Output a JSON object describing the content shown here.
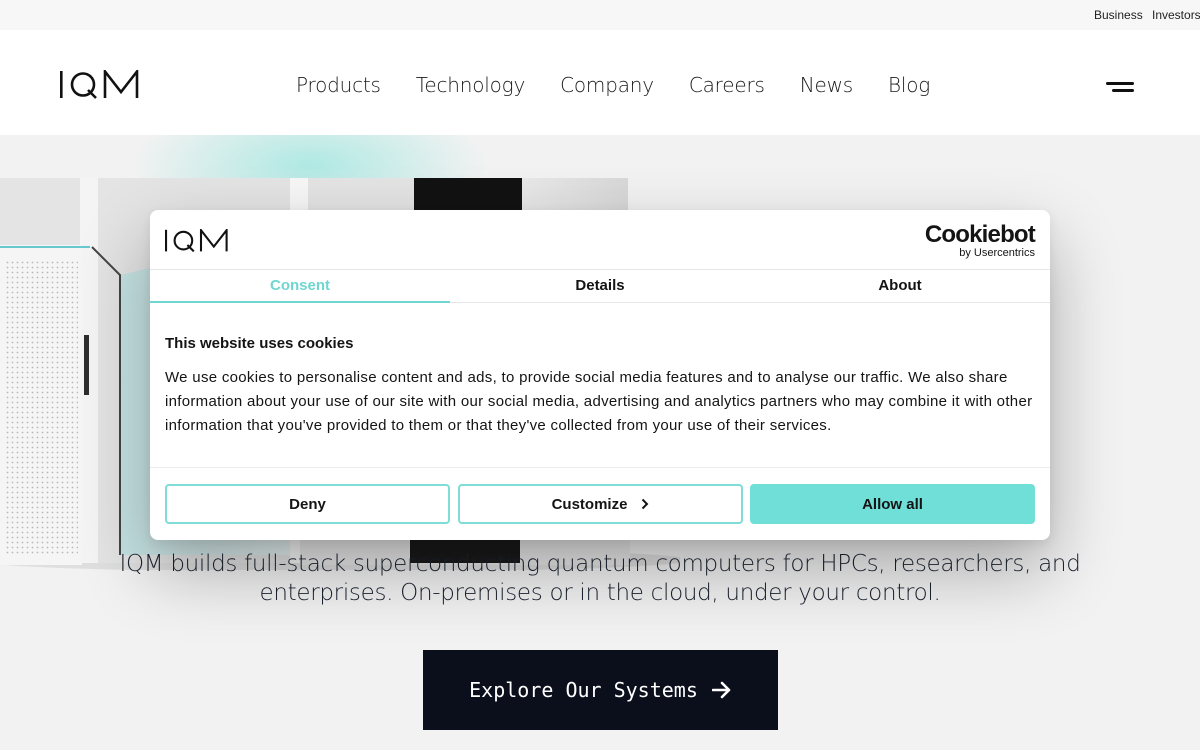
{
  "util_links": [
    "Business",
    "Investors"
  ],
  "header": {
    "brand": "IQM",
    "nav": [
      "Products",
      "Technology",
      "Company",
      "Careers",
      "News",
      "Blog"
    ]
  },
  "hero": {
    "line1": "IQM builds full-stack superconducting quantum computers for HPCs, researchers, and",
    "line2": "enterprises. On-premises or in the cloud, under your control.",
    "cta_label": "Explore Our Systems"
  },
  "cookie": {
    "provider_main": "Cookiebot",
    "provider_sub": "by Usercentrics",
    "tabs": [
      "Consent",
      "Details",
      "About"
    ],
    "active_tab": "Consent",
    "title": "This website uses cookies",
    "description": "We use cookies to personalise content and ads, to provide social media features and to analyse our traffic. We also share information about your use of our site with our social media, advertising and analytics partners who may combine it with other information that you've provided to them or that they've collected from your use of their services.",
    "deny_label": "Deny",
    "customize_label": "Customize",
    "allow_label": "Allow all"
  },
  "colors": {
    "accent": "#6fdfd8",
    "cta_bg": "#0b0f1c",
    "text": "#141414"
  },
  "icons": [
    "iqm-logo",
    "menu-icon",
    "arrow-right-icon",
    "chevron-right-icon"
  ]
}
